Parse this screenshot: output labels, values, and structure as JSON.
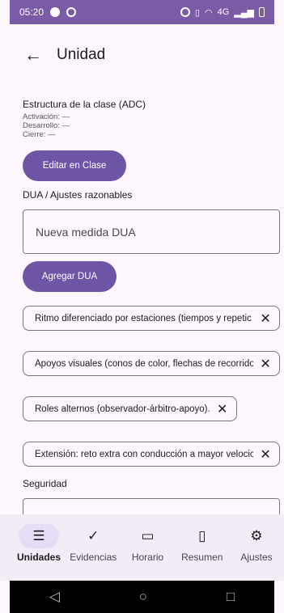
{
  "status_bar": {
    "time": "05:20",
    "network": "4G"
  },
  "app_bar": {
    "title": "Unidad"
  },
  "adc": {
    "title": "Estructura de la clase (ADC)",
    "activacion": "Activación: —",
    "desarrollo": "Desarrollo: —",
    "cierre": "Cierre: —",
    "edit_button": "Editar en Clase"
  },
  "dua": {
    "label": "DUA / Ajustes razonables",
    "input_placeholder": "Nueva medida DUA",
    "add_button": "Agregar DUA",
    "chips": [
      "Ritmo diferenciado por estaciones (tiempos y repetic",
      "Apoyos visuales (conos de color, flechas de recorrido",
      "Roles alternos (observador-árbitro-apoyo).",
      "Extensión: reto extra con conducción a mayor velocic"
    ]
  },
  "seguridad": {
    "label": "Seguridad"
  },
  "bottom_nav": {
    "items": [
      {
        "label": "Unidades",
        "icon": "menu-icon"
      },
      {
        "label": "Evidencias",
        "icon": "check-icon"
      },
      {
        "label": "Horario",
        "icon": "calendar-icon"
      },
      {
        "label": "Resumen",
        "icon": "clipboard-icon"
      },
      {
        "label": "Ajustes",
        "icon": "gear-icon"
      }
    ]
  },
  "colors": {
    "accent": "#6f55a6",
    "status_bar": "#7b5aa6",
    "background": "#fdf6fd",
    "nav_bg": "#f1ecf5"
  }
}
